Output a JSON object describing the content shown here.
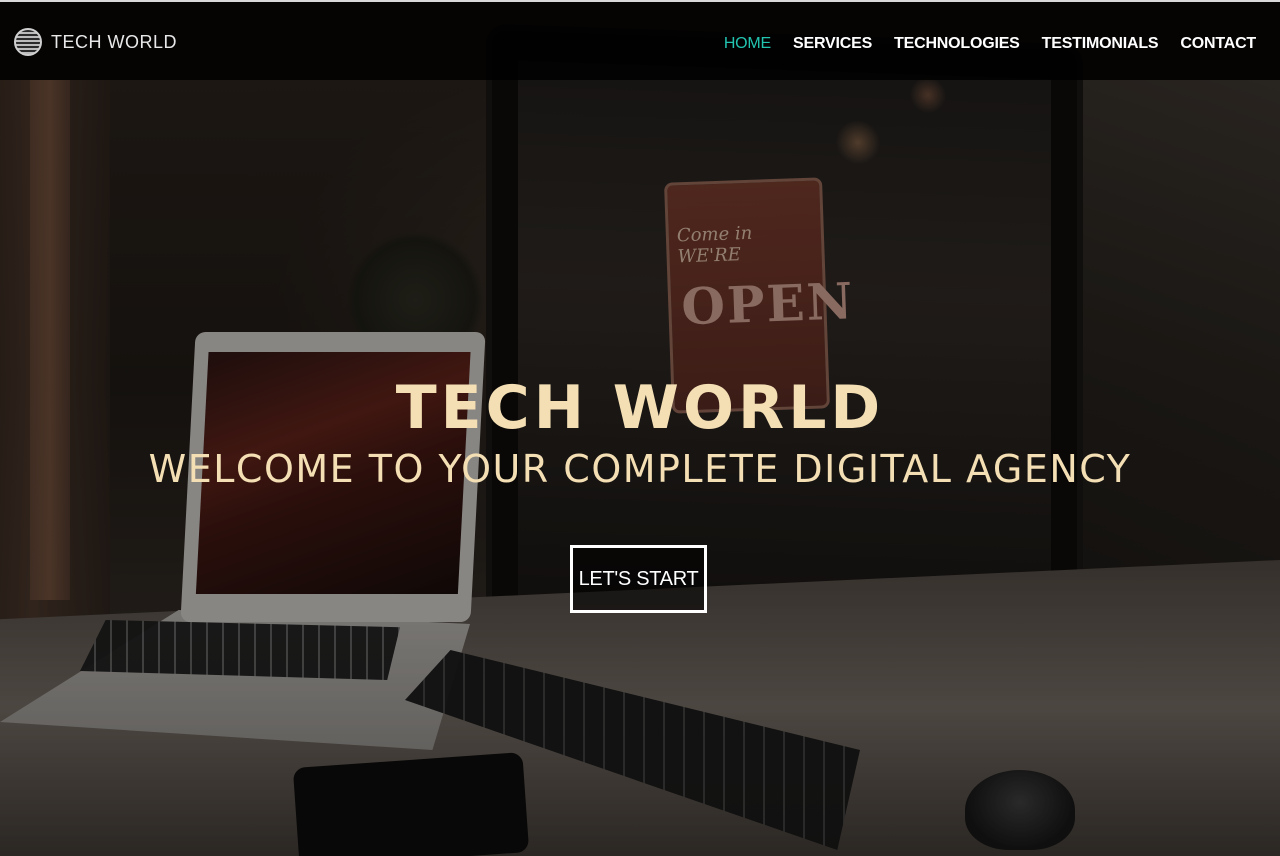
{
  "brand": {
    "name": "TECH WORLD",
    "icon": "globe-logo-icon"
  },
  "nav": {
    "items": [
      {
        "label": "HOME",
        "active": true
      },
      {
        "label": "SERVICES",
        "active": false
      },
      {
        "label": "TECHNOLOGIES",
        "active": false
      },
      {
        "label": "TESTIMONIALS",
        "active": false
      },
      {
        "label": "CONTACT",
        "active": false
      }
    ],
    "active_color": "#22c4b0"
  },
  "hero": {
    "title": "TECH WORLD",
    "subtitle": "WELCOME TO YOUR COMPLETE DIGITAL AGENCY",
    "cta_label": "LET'S START",
    "text_color": "#f4dfb4"
  }
}
